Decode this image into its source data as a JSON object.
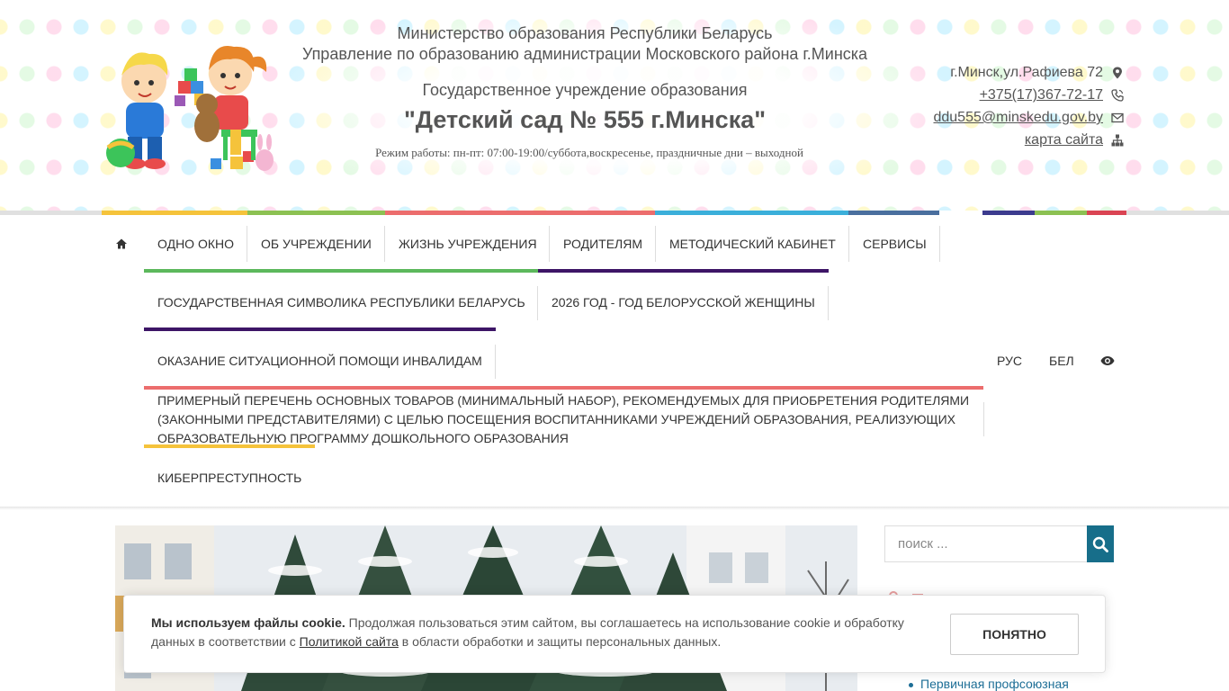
{
  "header": {
    "ministry": "Министерство образования Республики Беларусь",
    "department": "Управление по образованию администрации Московского района г.Минска",
    "institution_type": "Государственное учреждение образования",
    "institution_name": "\"Детский сад № 555 г.Минска\"",
    "hours": "Режим работы: пн-пт: 07:00-19:00/суббота,воскресенье, праздничные дни – выходной"
  },
  "contacts": {
    "address": "г.Минск,ул.Рафиева 72",
    "phone": "+375(17)367-72-17",
    "email": "ddu555@minskedu.gov.by",
    "sitemap": "карта сайта"
  },
  "colorbar": [
    "#f5c33b",
    "#8cc152",
    "#ec6d6d",
    "#f0a04b",
    "#3bafda",
    "#4a6f9e",
    "#ffffff",
    "#3c3b8e",
    "#8cc152",
    "#da4453"
  ],
  "nav": {
    "items": [
      "ОДНО ОКНО",
      "ОБ УЧРЕЖДЕНИИ",
      "ЖИЗНЬ УЧРЕЖДЕНИЯ",
      "РОДИТЕЛЯМ",
      "МЕТОДИЧЕСКИЙ КАБИНЕТ",
      "СЕРВИСЫ",
      "ГОСУДАРСТВЕННАЯ СИМВОЛИКА РЕСПУБЛИКИ БЕЛАРУСЬ",
      "2026 ГОД - ГОД БЕЛОРУССКОЙ ЖЕНЩИНЫ",
      "ОКАЗАНИЕ СИТУАЦИОННОЙ ПОМОЩИ ИНВАЛИДАМ",
      "ПРИМЕРНЫЙ ПЕРЕЧЕНЬ ОСНОВНЫХ ТОВАРОВ (МИНИМАЛЬНЫЙ НАБОР), РЕКОМЕНДУЕМЫХ ДЛЯ ПРИОБРЕТЕНИЯ РОДИТЕЛЯМИ (ЗАКОННЫМИ ПРЕДСТАВИТЕЛЯМИ) С ЦЕЛЬЮ ПОСЕЩЕНИЯ ВОСПИТАННИКАМИ УЧРЕЖДЕНИЙ ОБРАЗОВАНИЯ, РЕАЛИЗУЮЩИХ ОБРАЗОВАТЕЛЬНУЮ ПРОГРАММУ ДОШКОЛЬНОГО ОБРАЗОВАНИЯ",
      "КИБЕРПРЕСТУПНОСТЬ"
    ],
    "underline_colors": {
      "green": "#5cb85c",
      "purple": "#3d1566",
      "red": "#ec6d6d",
      "yellow": "#f5c33b"
    },
    "lang_ru": "РУС",
    "lang_by": "БЕЛ",
    "home_icon": "home-icon",
    "accessibility_icon": "eye-icon"
  },
  "search": {
    "placeholder": "поиск ...",
    "button_icon": "search-icon",
    "button_color": "#176e8a"
  },
  "sidebar": {
    "link": "Первичная профсоюзная"
  },
  "cookie": {
    "bold": "Мы используем файлы cookie.",
    "text1": " Продолжая пользоваться этим сайтом, вы соглашаетесь на использование cookie и обработку данных в соответствии с ",
    "policy": "Политикой сайта",
    "text2": " в области обработки и защиты персональных данных.",
    "button": "ПОНЯТНО"
  }
}
